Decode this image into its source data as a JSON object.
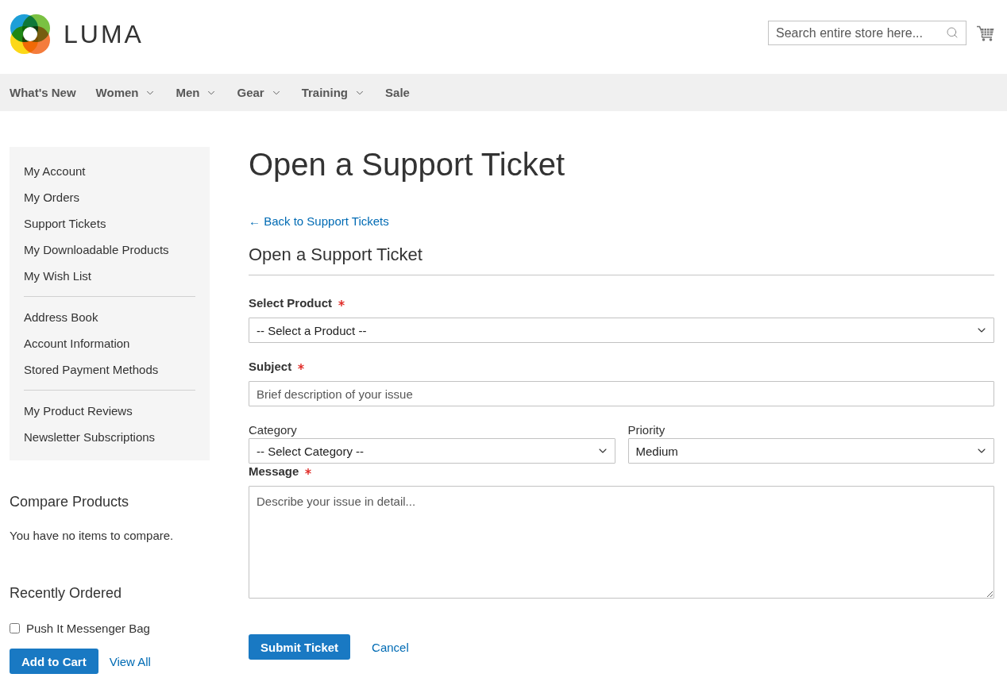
{
  "header": {
    "logo": {
      "text": "LUMA"
    },
    "search": {
      "placeholder": "Search entire store here..."
    }
  },
  "nav": [
    {
      "label": "What's New",
      "has_submenu": false
    },
    {
      "label": "Women",
      "has_submenu": true
    },
    {
      "label": "Men",
      "has_submenu": true
    },
    {
      "label": "Gear",
      "has_submenu": true
    },
    {
      "label": "Training",
      "has_submenu": true
    },
    {
      "label": "Sale",
      "has_submenu": false
    }
  ],
  "account_nav": {
    "groups": [
      {
        "items": [
          {
            "label": "My Account",
            "selected": false
          },
          {
            "label": "My Orders",
            "selected": false
          },
          {
            "label": "Support Tickets",
            "selected": false
          },
          {
            "label": "My Downloadable Products",
            "selected": false
          },
          {
            "label": "My Wish List",
            "selected": false
          }
        ]
      },
      {
        "items": [
          {
            "label": "Address Book",
            "selected": false
          },
          {
            "label": "Account Information",
            "selected": false
          },
          {
            "label": "Stored Payment Methods",
            "selected": false
          }
        ]
      },
      {
        "items": [
          {
            "label": "My Product Reviews",
            "selected": false
          },
          {
            "label": "Newsletter Subscriptions",
            "selected": false
          }
        ]
      }
    ]
  },
  "compare_products": {
    "title": "Compare Products",
    "empty_text": "You have no items to compare."
  },
  "recently_ordered": {
    "title": "Recently Ordered",
    "items": [
      {
        "label": "Push It Messenger Bag",
        "checked": false
      }
    ],
    "add_to_cart": "Add to Cart",
    "view_all": "View All"
  },
  "page_title": "Open a Support Ticket",
  "back_link": "← Back to Support Tickets",
  "form": {
    "title": "Open a Support Ticket",
    "fields": [
      {
        "kind": "select",
        "label": "Select Product",
        "required": true,
        "value": "-- Select a Product --"
      },
      {
        "kind": "text",
        "label": "Subject",
        "required": true,
        "placeholder": "Brief description of your issue"
      },
      {
        "kind": "row",
        "fields": [
          {
            "kind": "select",
            "label": "Category",
            "required": false,
            "value": "-- Select Category --"
          },
          {
            "kind": "select",
            "label": "Priority",
            "required": false,
            "value": "Medium"
          }
        ]
      },
      {
        "kind": "textarea",
        "label": "Message",
        "required": true,
        "placeholder": "Describe your issue in detail..."
      }
    ],
    "submit": "Submit Ticket",
    "cancel": "Cancel"
  }
}
